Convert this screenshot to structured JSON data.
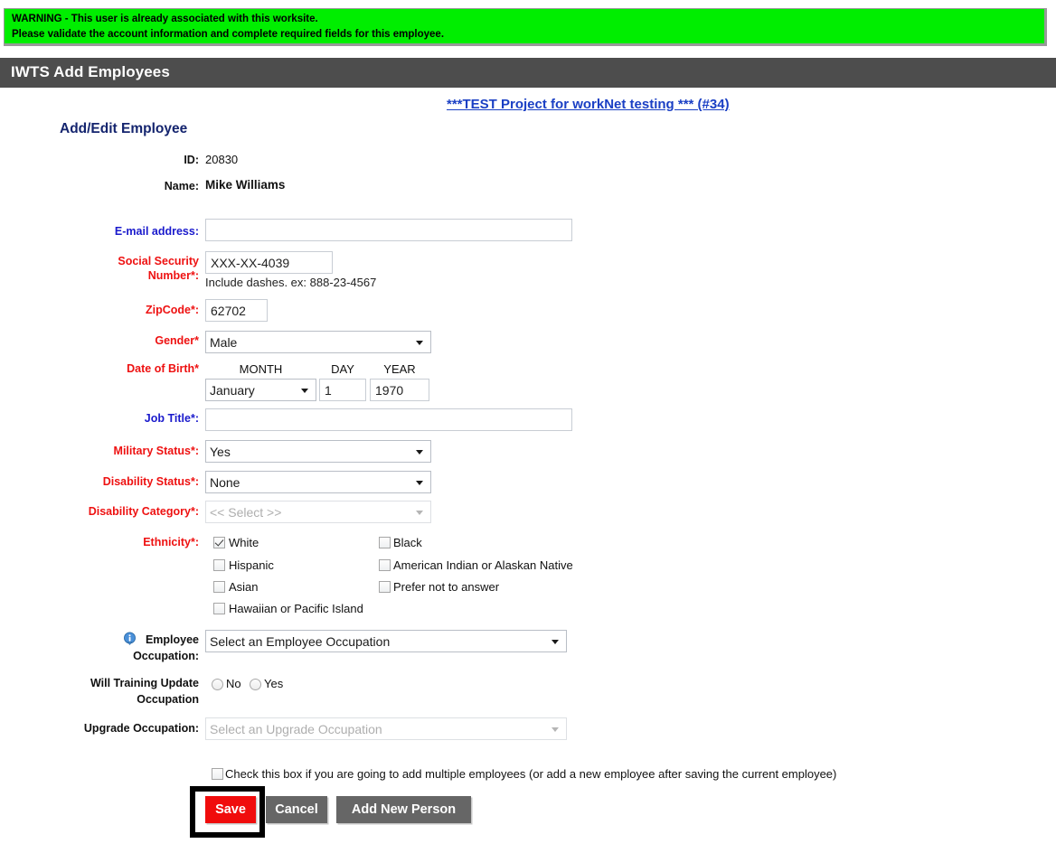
{
  "warning": {
    "line1": "WARNING - This user is already associated with this worksite.",
    "line2": "Please validate the account information and complete required fields for this employee.",
    "bg_color": "#00ee00"
  },
  "header": {
    "title": "IWTS Add Employees",
    "bg_color": "#4d4d4d"
  },
  "project": {
    "link_text": "***TEST Project for workNet testing *** (#34)",
    "link_color": "#1a3fc4"
  },
  "form": {
    "section_heading": "Add/Edit Employee",
    "id_label": "ID:",
    "id_value": "20830",
    "name_label": "Name:",
    "name_value": "Mike Williams",
    "email_label": "E-mail address:",
    "email_value": "",
    "email_placeholder": "",
    "ssn_label_line1": "Social Security",
    "ssn_label_line2": "Number*:",
    "ssn_value": "XXX-XX-4039",
    "ssn_hint": "Include dashes. ex: 888-23-4567",
    "zip_label": "ZipCode*:",
    "zip_value": "62702",
    "gender_label": "Gender*",
    "gender_value": "Male",
    "dob_label": "Date of Birth*",
    "dob_month_header": "MONTH",
    "dob_day_header": "DAY",
    "dob_year_header": "YEAR",
    "dob_month_value": "January",
    "dob_day_value": "1",
    "dob_year_value": "1970",
    "job_title_label": "Job Title*:",
    "job_title_value": "",
    "military_label": "Military Status*:",
    "military_value": "Yes",
    "disability_status_label": "Disability Status*:",
    "disability_status_value": "None",
    "disability_category_label": "Disability Category*:",
    "disability_category_value": "<< Select >>",
    "ethnicity_label": "Ethnicity*:",
    "ethnicity": [
      {
        "label": "White",
        "checked": true
      },
      {
        "label": "Black",
        "checked": false
      },
      {
        "label": "Hispanic",
        "checked": false
      },
      {
        "label": "American Indian or Alaskan Native",
        "checked": false
      },
      {
        "label": "Asian",
        "checked": false
      },
      {
        "label": "Prefer not to answer",
        "checked": false
      },
      {
        "label": "Hawaiian or Pacific Island",
        "checked": false
      }
    ],
    "employee_occupation_label_line1": "Employee",
    "employee_occupation_label_line2": "Occupation:",
    "employee_occupation_value": "Select an Employee Occupation",
    "training_update_label_line1": "Will Training Update",
    "training_update_label_line2": "Occupation",
    "training_update_no": "No",
    "training_update_yes": "Yes",
    "upgrade_occupation_label": "Upgrade Occupation:",
    "upgrade_occupation_value": "Select an Upgrade Occupation",
    "multi_employee_checkbox_label": "Check this box if you are going to add multiple employees (or add a new employee after saving the current employee)"
  },
  "buttons": {
    "save": "Save",
    "cancel": "Cancel",
    "add_new_person": "Add New Person",
    "save_color": "#f00c0c",
    "grey_color": "#666666"
  },
  "icons": {
    "info": "info-icon"
  }
}
